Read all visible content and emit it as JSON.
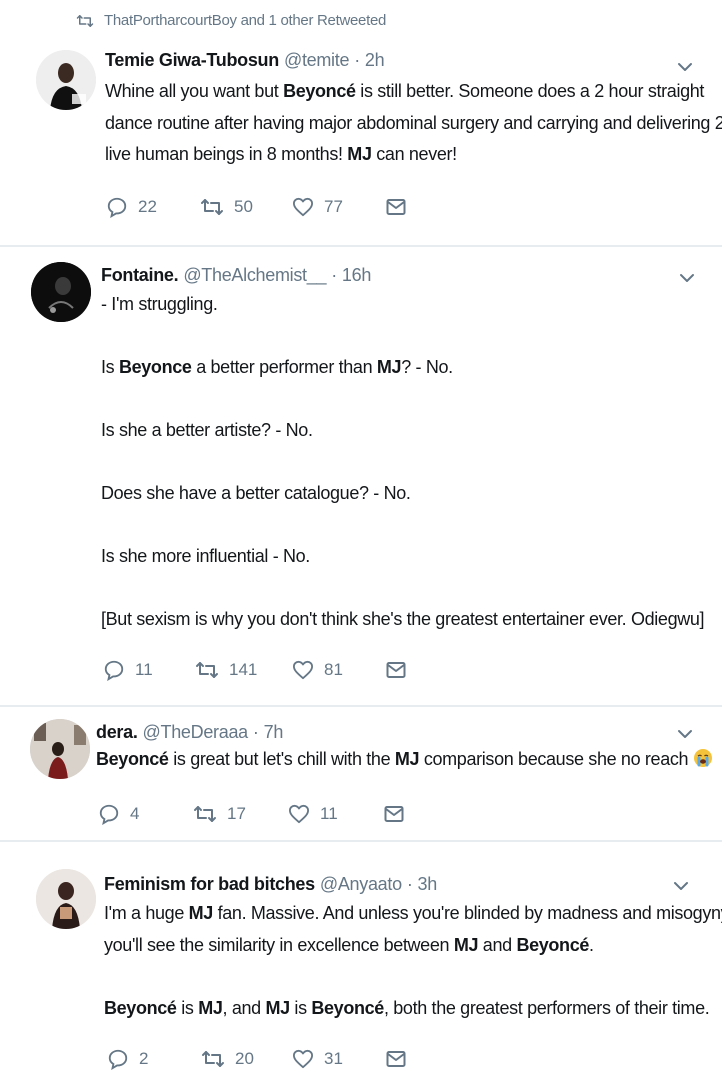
{
  "social_context": "ThatPortharcourtBoy and 1 other Retweeted",
  "tweets": [
    {
      "name": "Temie Giwa-Tubosun",
      "handle": "@temite",
      "sep": "·",
      "time": "2h",
      "lines": [
        [
          [
            "Whine all you want but ",
            false
          ],
          [
            "Beyoncé",
            true
          ],
          [
            " is still better. Someone does a 2 hour straight",
            false
          ]
        ],
        [
          [
            "dance routine after having major abdominal surgery and carrying and delivering 2",
            false
          ]
        ],
        [
          [
            "live human beings in 8 months! ",
            false
          ],
          [
            "MJ",
            true
          ],
          [
            " can never!",
            false
          ]
        ]
      ],
      "replies": "22",
      "retweets": "50",
      "likes": "77"
    },
    {
      "name": "Fontaine.",
      "handle": "@TheAlchemist__",
      "sep": "·",
      "time": "16h",
      "lines": [
        [
          [
            "- I'm struggling.",
            false
          ]
        ],
        [],
        [
          [
            "Is ",
            false
          ],
          [
            "Beyonce",
            true
          ],
          [
            " a better performer than ",
            false
          ],
          [
            "MJ",
            true
          ],
          [
            "? - No.",
            false
          ]
        ],
        [],
        [
          [
            "Is she a better artiste? - No.",
            false
          ]
        ],
        [],
        [
          [
            "Does she have a better catalogue? - No.",
            false
          ]
        ],
        [],
        [
          [
            "Is she more influential - No.",
            false
          ]
        ],
        [],
        [
          [
            "[But sexism is why you don't think she's the greatest entertainer ever. Odiegwu]",
            false
          ]
        ]
      ],
      "replies": "11",
      "retweets": "141",
      "likes": "81"
    },
    {
      "name": "dera.",
      "handle": "@TheDeraaa",
      "sep": "·",
      "time": "7h",
      "lines": [
        [
          [
            "Beyoncé",
            true
          ],
          [
            " is great but let's chill with the ",
            false
          ],
          [
            "MJ",
            true
          ],
          [
            " comparison because she no reach ",
            false
          ]
        ]
      ],
      "emoji": "loudly-crying-face",
      "replies": "4",
      "retweets": "17",
      "likes": "11"
    },
    {
      "name": "Feminism for bad bitches",
      "handle": "@Anyaato",
      "sep": "·",
      "time": "3h",
      "lines": [
        [
          [
            "I'm a huge ",
            false
          ],
          [
            "MJ",
            true
          ],
          [
            " fan. Massive. And unless you're blinded by madness and misogyny",
            false
          ]
        ],
        [
          [
            "you'll see the similarity in excellence between ",
            false
          ],
          [
            "MJ",
            true
          ],
          [
            " and ",
            false
          ],
          [
            "Beyoncé",
            true
          ],
          [
            ".",
            false
          ]
        ],
        [],
        [
          [
            "Beyoncé",
            true
          ],
          [
            " is ",
            false
          ],
          [
            "MJ",
            true
          ],
          [
            ", and ",
            false
          ],
          [
            "MJ",
            true
          ],
          [
            " is ",
            false
          ],
          [
            "Beyoncé",
            true
          ],
          [
            ", both the greatest performers of their time.",
            false
          ]
        ]
      ],
      "replies": "2",
      "retweets": "20",
      "likes": "31"
    }
  ],
  "icons": {
    "retweeted": "retweet-icon",
    "reply": "reply-icon",
    "retweet": "retweet-icon",
    "like": "heart-icon",
    "dm": "envelope-icon",
    "more": "chevron-down-icon"
  },
  "colors": {
    "text": "#14171a",
    "secondary": "#657786",
    "divider": "#e6ecf0"
  }
}
